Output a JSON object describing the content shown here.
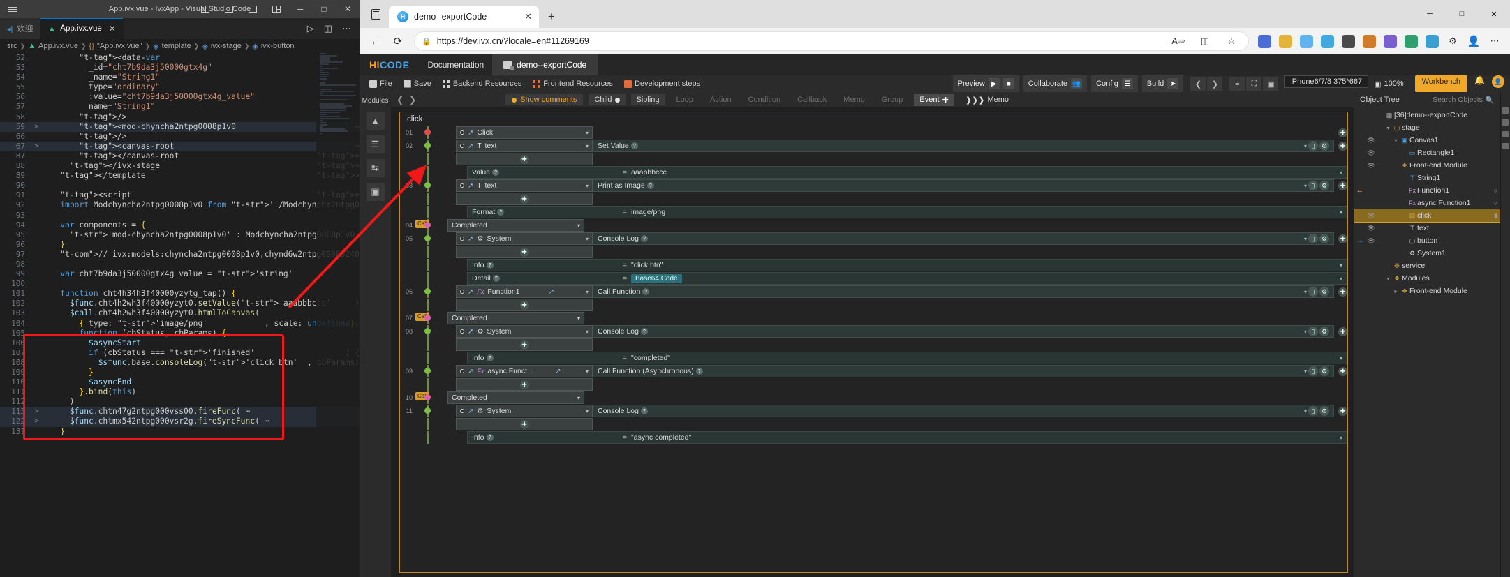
{
  "vscode": {
    "window_title": "App.ivx.vue - IvxApp - Visual Studio Code",
    "tabs": [
      {
        "label": "欢迎",
        "icon": "vscode-icon",
        "active": false
      },
      {
        "label": "App.ivx.vue",
        "icon": "vue-icon",
        "active": true,
        "close": "✕"
      }
    ],
    "breadcrumb": [
      "src",
      "App.ivx.vue",
      "\"App.ivx.vue\"",
      "template",
      "ivx-stage",
      "ivx-button"
    ],
    "code_lines": [
      {
        "n": "52",
        "fold": "",
        "hl": false,
        "text": "        <data-var"
      },
      {
        "n": "53",
        "fold": "",
        "hl": false,
        "text": "          _id=\"cht7b9da3j50000gtx4g\""
      },
      {
        "n": "54",
        "fold": "",
        "hl": false,
        "text": "          _name=\"String1\""
      },
      {
        "n": "55",
        "fold": "",
        "hl": false,
        "text": "          type=\"ordinary\""
      },
      {
        "n": "56",
        "fold": "",
        "hl": false,
        "text": "          :value=\"cht7b9da3j50000gtx4g_value\""
      },
      {
        "n": "57",
        "fold": "",
        "hl": false,
        "text": "          name=\"String1\""
      },
      {
        "n": "58",
        "fold": "",
        "hl": false,
        "text": "        />"
      },
      {
        "n": "59",
        "fold": ">",
        "hl": true,
        "text": "        <mod-chyncha2ntpg0008p1v0 ⋯"
      },
      {
        "n": "66",
        "fold": "",
        "hl": false,
        "text": "        />"
      },
      {
        "n": "67",
        "fold": ">",
        "hl": true,
        "text": "        <canvas-root ⋯"
      },
      {
        "n": "87",
        "fold": "",
        "hl": false,
        "text": "        </canvas-root>"
      },
      {
        "n": "88",
        "fold": "",
        "hl": false,
        "text": "      </ivx-stage>"
      },
      {
        "n": "89",
        "fold": "",
        "hl": false,
        "text": "    </template>"
      },
      {
        "n": "90",
        "fold": "",
        "hl": false,
        "text": ""
      },
      {
        "n": "91",
        "fold": "",
        "hl": false,
        "text": "    <script>"
      },
      {
        "n": "92",
        "fold": "",
        "hl": false,
        "text": "    import Modchyncha2ntpg0008p1v0 from './Modchyncha2ntpg0008p1v0'"
      },
      {
        "n": "93",
        "fold": "",
        "hl": false,
        "text": ""
      },
      {
        "n": "94",
        "fold": "",
        "hl": false,
        "text": "    var components = {"
      },
      {
        "n": "95",
        "fold": "",
        "hl": false,
        "text": "      'mod-chyncha2ntpg0008p1v0': Modchyncha2ntpg0008p1v0,"
      },
      {
        "n": "96",
        "fold": "",
        "hl": false,
        "text": "    }"
      },
      {
        "n": "97",
        "fold": "",
        "hl": false,
        "text": "    // ivx:models:chyncha2ntpg0008p1v0,chynd6w2ntpg0008p240"
      },
      {
        "n": "98",
        "fold": "",
        "hl": false,
        "text": ""
      },
      {
        "n": "99",
        "fold": "",
        "hl": false,
        "text": "    var cht7b9da3j50000gtx4g_value = 'string'"
      },
      {
        "n": "100",
        "fold": "",
        "hl": false,
        "text": ""
      },
      {
        "n": "101",
        "fold": "",
        "hl": false,
        "text": "    function cht4h34h3f40000yzytg_tap() {"
      },
      {
        "n": "102",
        "fold": "",
        "hl": false,
        "text": "      $func.cht4h2wh3f40000yzyt0.setValue('aaabbbccc')"
      },
      {
        "n": "103",
        "fold": "",
        "hl": false,
        "text": "      $call.cht4h2wh3f40000yzyt0.htmlToCanvas("
      },
      {
        "n": "104",
        "fold": "",
        "hl": false,
        "text": "        { type: 'image/png', scale: undefined },"
      },
      {
        "n": "105",
        "fold": "",
        "hl": false,
        "text": "        function (cbStatus, cbParams) {"
      },
      {
        "n": "106",
        "fold": "",
        "hl": false,
        "text": "          $asyncStart"
      },
      {
        "n": "107",
        "fold": "",
        "hl": false,
        "text": "          if (cbStatus === 'finished') {"
      },
      {
        "n": "108",
        "fold": "",
        "hl": false,
        "text": "            $sfunc.base.consoleLog('click btn', cbParams)"
      },
      {
        "n": "109",
        "fold": "",
        "hl": false,
        "text": "          }"
      },
      {
        "n": "110",
        "fold": "",
        "hl": false,
        "text": "          $asyncEnd"
      },
      {
        "n": "111",
        "fold": "",
        "hl": false,
        "text": "        }.bind(this)"
      },
      {
        "n": "112",
        "fold": "",
        "hl": false,
        "text": "      )"
      },
      {
        "n": "113",
        "fold": ">",
        "hl": true,
        "text": "      $func.chtn47g2ntpg000vss00.fireFunc( ⋯"
      },
      {
        "n": "122",
        "fold": ">",
        "hl": true,
        "text": "      $func.chtmx542ntpg000vsr2g.fireSyncFunc( ⋯"
      },
      {
        "n": "131",
        "fold": "",
        "hl": false,
        "text": "    }"
      }
    ]
  },
  "browser": {
    "tab_title": "demo--exportCode",
    "tab_favicon_text": "H",
    "url": "https://dev.ivx.cn/?locale=en#11269169",
    "lock_icon": "lock-icon",
    "new_tab": "+",
    "tab_close": "✕",
    "window_controls": {
      "minimize": "—",
      "maximize": "▢",
      "close": "✕"
    },
    "nav": {
      "back": "←",
      "reload": "⟳"
    },
    "omni_actions": {
      "read_aloud": "A⟩",
      "split": "▯▯",
      "favorite": "☆"
    }
  },
  "ivx": {
    "logo": {
      "hi": "HI",
      "code": "CODE"
    },
    "menu": "Documentation",
    "doc_tab": "demo--exportCode",
    "toolbar_left": [
      {
        "label": "File",
        "icon": "file-icon"
      },
      {
        "label": "Save",
        "icon": "save-icon"
      },
      {
        "label": "Backend Resources",
        "icon": "backend-icon"
      },
      {
        "label": "Frontend Resources",
        "icon": "frontend-icon"
      },
      {
        "label": "Development steps",
        "icon": "steps-icon"
      }
    ],
    "toolbar_right": {
      "preview": "Preview",
      "collaborate": "Collaborate",
      "config": "Config",
      "build": "Build",
      "device": "iPhone6/7/8 375*667",
      "zoom": "100%",
      "workbench": "Workbench"
    },
    "canvas_header": {
      "show_comments": "Show comments",
      "child": "Child",
      "sibling": "Sibling",
      "dim_items": [
        "Loop",
        "Action",
        "Condition",
        "Callback",
        "Memo",
        "Group"
      ],
      "event_btn": "Event",
      "memo_btn": "Memo"
    },
    "flow": {
      "title": "click",
      "rows": [
        {
          "num": "01",
          "dot": "red",
          "left": "Click",
          "left_icon": "none",
          "right": "",
          "tag": ""
        },
        {
          "num": "02",
          "dot": "green",
          "left": "text",
          "left_icon": "text-icon",
          "right": "Set Value",
          "tag": ""
        },
        {
          "num": "",
          "kv": true,
          "key": "Value",
          "val": "aaabbbccc"
        },
        {
          "num": "03",
          "dot": "green",
          "left": "text",
          "left_icon": "text-icon",
          "right": "Print as Image",
          "tag": ""
        },
        {
          "num": "",
          "kv": true,
          "key": "Format",
          "val": "image/png"
        },
        {
          "num": "04",
          "dot": "pink",
          "left": "Completed",
          "left_icon": "none",
          "right": "",
          "tag": "Call"
        },
        {
          "num": "05",
          "dot": "green",
          "left": "System",
          "left_icon": "gear-icon",
          "right": "Console Log",
          "tag": ""
        },
        {
          "num": "",
          "kv": true,
          "key": "Info",
          "val": "\"click btn\""
        },
        {
          "num": "",
          "kv": true,
          "key": "Detail",
          "val": "Base64 Code"
        },
        {
          "num": "06",
          "dot": "green",
          "left": "Function1",
          "left_icon": "fx-icon",
          "right": "Call Function",
          "tag": ""
        },
        {
          "num": "07",
          "dot": "pink",
          "left": "Completed",
          "left_icon": "none",
          "right": "",
          "tag": "Call"
        },
        {
          "num": "08",
          "dot": "green",
          "left": "System",
          "left_icon": "gear-icon",
          "right": "Console Log",
          "tag": ""
        },
        {
          "num": "",
          "kv": true,
          "key": "Info",
          "val": "\"completed\""
        },
        {
          "num": "09",
          "dot": "green",
          "left": "async Funct...",
          "left_icon": "fx-icon",
          "right": "Call Function (Asynchronous)",
          "tag": ""
        },
        {
          "num": "10",
          "dot": "pink",
          "left": "Completed",
          "left_icon": "none",
          "right": "",
          "tag": "Call"
        },
        {
          "num": "11",
          "dot": "green",
          "left": "System",
          "left_icon": "gear-icon",
          "right": "Console Log",
          "tag": ""
        },
        {
          "num": "",
          "kv": true,
          "key": "Info",
          "val": "\"async completed\""
        }
      ]
    },
    "object_tree": {
      "title": "Object Tree",
      "search_placeholder": "Search Objects",
      "items": [
        {
          "indent": 0,
          "eye": false,
          "tw": "",
          "icon": "page-icon",
          "label": "[36]demo--exportCode",
          "sel": false
        },
        {
          "indent": 1,
          "eye": false,
          "tw": "▾",
          "icon": "stage-icon",
          "label": "stage",
          "sel": false
        },
        {
          "indent": 2,
          "eye": true,
          "tw": "▾",
          "icon": "canvas-icon",
          "label": "Canvas1",
          "sel": false
        },
        {
          "indent": 3,
          "eye": true,
          "tw": "",
          "icon": "rect-icon",
          "label": "Rectangle1",
          "sel": false
        },
        {
          "indent": 2,
          "eye": true,
          "tw": "",
          "icon": "module-icon",
          "label": "Front-end Module",
          "sel": false
        },
        {
          "indent": 3,
          "eye": false,
          "tw": "",
          "icon": "string-icon",
          "label": "String1",
          "sel": false
        },
        {
          "indent": 3,
          "eye": false,
          "tw": "",
          "icon": "fx-icon",
          "label": "Function1",
          "sel": false,
          "back": true
        },
        {
          "indent": 3,
          "eye": false,
          "tw": "",
          "icon": "fx-icon",
          "label": "async Function1",
          "sel": false
        },
        {
          "indent": 3,
          "eye": true,
          "tw": "",
          "icon": "event-icon",
          "label": "click",
          "sel": true
        },
        {
          "indent": 3,
          "eye": true,
          "tw": "",
          "icon": "text-icon",
          "label": "text",
          "sel": false
        },
        {
          "indent": 3,
          "eye": true,
          "tw": "",
          "icon": "button-icon",
          "label": "button",
          "sel": false,
          "arrow": true
        },
        {
          "indent": 3,
          "eye": false,
          "tw": "",
          "icon": "gear-icon",
          "label": "System1",
          "sel": false
        },
        {
          "indent": 1,
          "eye": false,
          "tw": "",
          "icon": "service-icon",
          "label": "service",
          "sel": false
        },
        {
          "indent": 1,
          "eye": false,
          "tw": "▾",
          "icon": "modules-icon",
          "label": "Modules",
          "sel": false
        },
        {
          "indent": 2,
          "eye": false,
          "tw": "▸",
          "icon": "module-icon",
          "label": "Front-end Module",
          "sel": false
        }
      ]
    }
  },
  "colors": {
    "accent_orange": "#f0a82a",
    "accent_blue": "#4aa3e8",
    "annotation_red": "#f01818",
    "vue_green": "#41b883"
  }
}
